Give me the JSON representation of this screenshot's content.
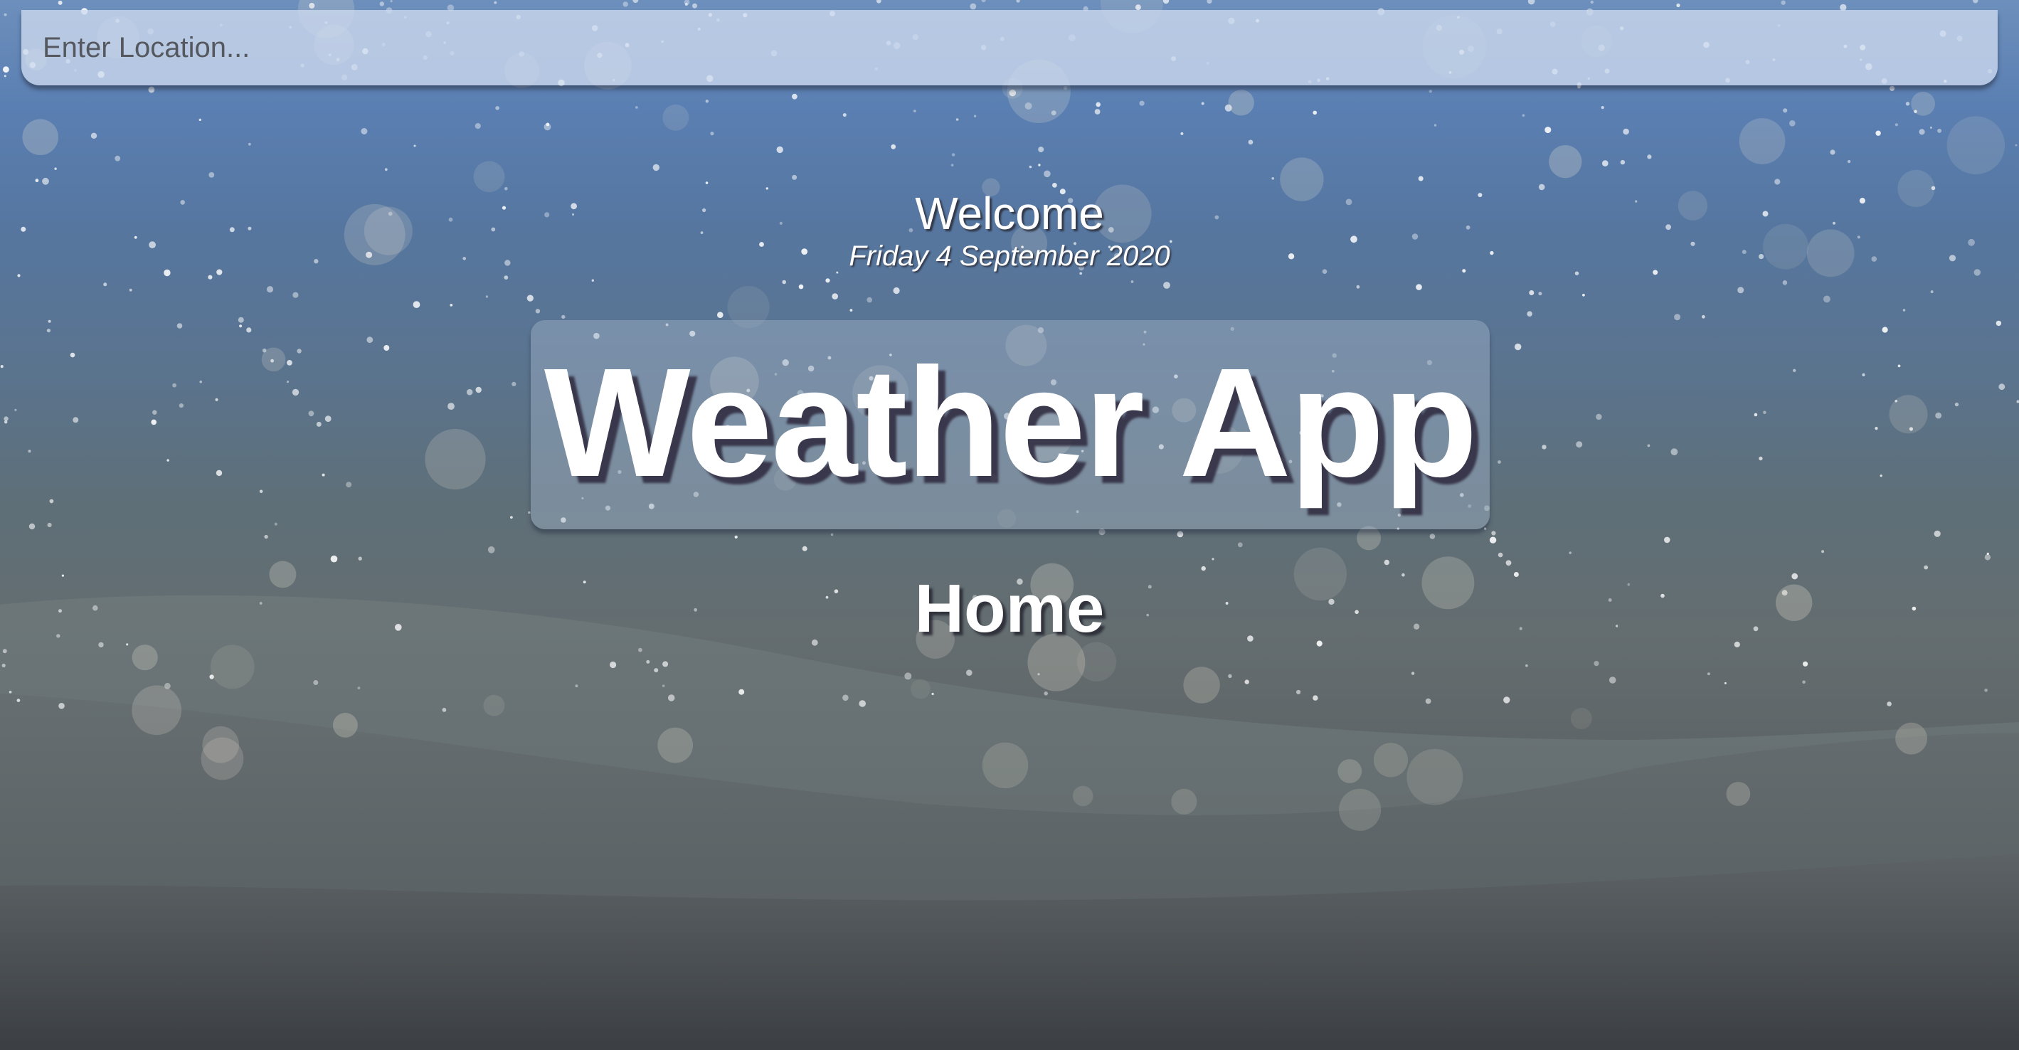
{
  "search": {
    "placeholder": "Enter Location...",
    "value": ""
  },
  "header": {
    "welcome": "Welcome",
    "date": "Friday 4 September 2020"
  },
  "main": {
    "title": "Weather App",
    "section": "Home"
  },
  "background": {
    "theme": "snow",
    "sky_color": "#5a7fb2",
    "ground_color": "#5e6468"
  }
}
